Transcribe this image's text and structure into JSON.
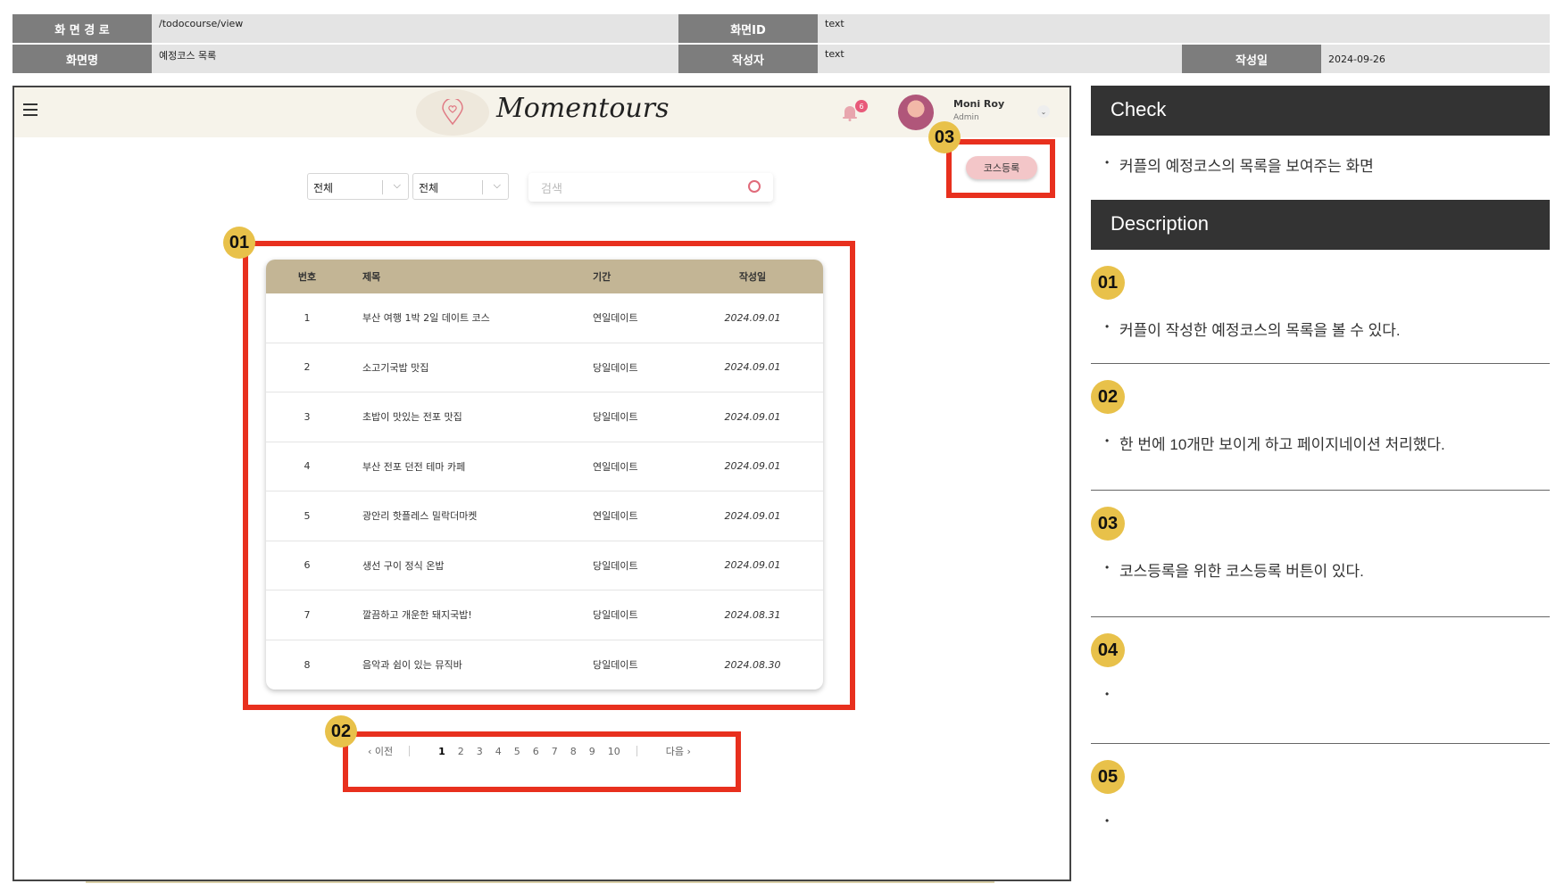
{
  "spec": {
    "path_label": "화 면 경 로",
    "path_value": "/todocourse/view",
    "screen_id_label": "화면ID",
    "screen_id_value": "text",
    "screen_name_label": "화면명",
    "screen_name_value": "예정코스 목록",
    "author_label": "작성자",
    "author_value": "text",
    "date_label": "작성일",
    "date_value": "2024-09-26"
  },
  "app": {
    "logo": "Momentours",
    "notif_count": "6",
    "user_name": "Moni Roy",
    "user_role": "Admin"
  },
  "filters": {
    "select1": "전체",
    "select2": "전체",
    "search_placeholder": "검색",
    "register_label": "코스등록"
  },
  "table": {
    "headers": {
      "no": "번호",
      "title": "제목",
      "period": "기간",
      "date": "작성일"
    },
    "rows": [
      {
        "no": "1",
        "title": "부산 여행 1박 2일 데이트 코스",
        "period": "연일데이트",
        "date": "2024.09.01"
      },
      {
        "no": "2",
        "title": "소고기국밥 맛집",
        "period": "당일데이트",
        "date": "2024.09.01"
      },
      {
        "no": "3",
        "title": "초밥이 맛있는 전포 맛집",
        "period": "당일데이트",
        "date": "2024.09.01"
      },
      {
        "no": "4",
        "title": "부산 전포 던전 테마 카페",
        "period": "연일데이트",
        "date": "2024.09.01"
      },
      {
        "no": "5",
        "title": "광안리 핫플레스 밀락더마켓",
        "period": "연일데이트",
        "date": "2024.09.01"
      },
      {
        "no": "6",
        "title": "생선 구이 정식 온밥",
        "period": "당일데이트",
        "date": "2024.09.01"
      },
      {
        "no": "7",
        "title": "깔끔하고 개운한 돼지국밥!",
        "period": "당일데이트",
        "date": "2024.08.31"
      },
      {
        "no": "8",
        "title": "음악과 쉼이 있는 뮤직바",
        "period": "당일데이트",
        "date": "2024.08.30"
      }
    ]
  },
  "pagination": {
    "prev": "‹ 이전",
    "pages": [
      "1",
      "2",
      "3",
      "4",
      "5",
      "6",
      "7",
      "8",
      "9",
      "10"
    ],
    "next": "다음 ›"
  },
  "markers": {
    "m1": "01",
    "m2": "02",
    "m3": "03"
  },
  "panel": {
    "check_title": "Check",
    "check_text": "커플의 예정코스의 목록을 보여주는 화면",
    "desc_title": "Description",
    "items": [
      {
        "num": "01",
        "text": "커플이 작성한 예정코스의 목록을 볼 수 있다."
      },
      {
        "num": "02",
        "text": "한 번에 10개만 보이게 하고 페이지네이션 처리했다."
      },
      {
        "num": "03",
        "text": "코스등록을 위한 코스등록 버튼이 있다."
      },
      {
        "num": "04",
        "text": ""
      },
      {
        "num": "05",
        "text": ""
      }
    ]
  }
}
